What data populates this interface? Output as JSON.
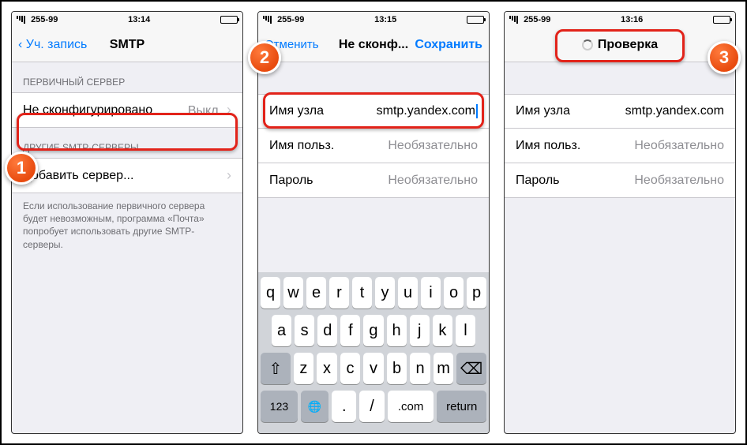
{
  "status": {
    "carrier": "255-99"
  },
  "phone1": {
    "time": "13:14",
    "back": "Уч. запись",
    "title": "SMTP",
    "section1": "ПЕРВИЧНЫЙ СЕРВЕР",
    "primary_label": "Не сконфигурировано",
    "primary_value": "Выкл.",
    "section2": "ДРУГИЕ SMTP-СЕРВЕРЫ",
    "add_server": "Добавить сервер...",
    "footer": "Если использование первичного сервера будет невозможным, программа «Почта» попробует использовать другие SMTP-серверы."
  },
  "phone2": {
    "time": "13:15",
    "cancel": "Отменить",
    "title": "Не сконф...",
    "save": "Сохранить",
    "host_label": "Имя узла",
    "host_value": "smtp.yandex.com",
    "user_label": "Имя польз.",
    "user_placeholder": "Необязательно",
    "pass_label": "Пароль",
    "pass_placeholder": "Необязательно",
    "kb": {
      "r1": [
        "q",
        "w",
        "e",
        "r",
        "t",
        "y",
        "u",
        "i",
        "o",
        "p"
      ],
      "r2": [
        "a",
        "s",
        "d",
        "f",
        "g",
        "h",
        "j",
        "k",
        "l"
      ],
      "r3": [
        "z",
        "x",
        "c",
        "v",
        "b",
        "n",
        "m"
      ],
      "num": "123",
      "dot": ".",
      "slash": "/",
      "com": ".com",
      "ret": "return"
    }
  },
  "phone3": {
    "time": "13:16",
    "title": "Проверка",
    "host_label": "Имя узла",
    "host_value": "smtp.yandex.com",
    "user_label": "Имя польз.",
    "user_placeholder": "Необязательно",
    "pass_label": "Пароль",
    "pass_placeholder": "Необязательно"
  },
  "badges": {
    "b1": "1",
    "b2": "2",
    "b3": "3"
  }
}
